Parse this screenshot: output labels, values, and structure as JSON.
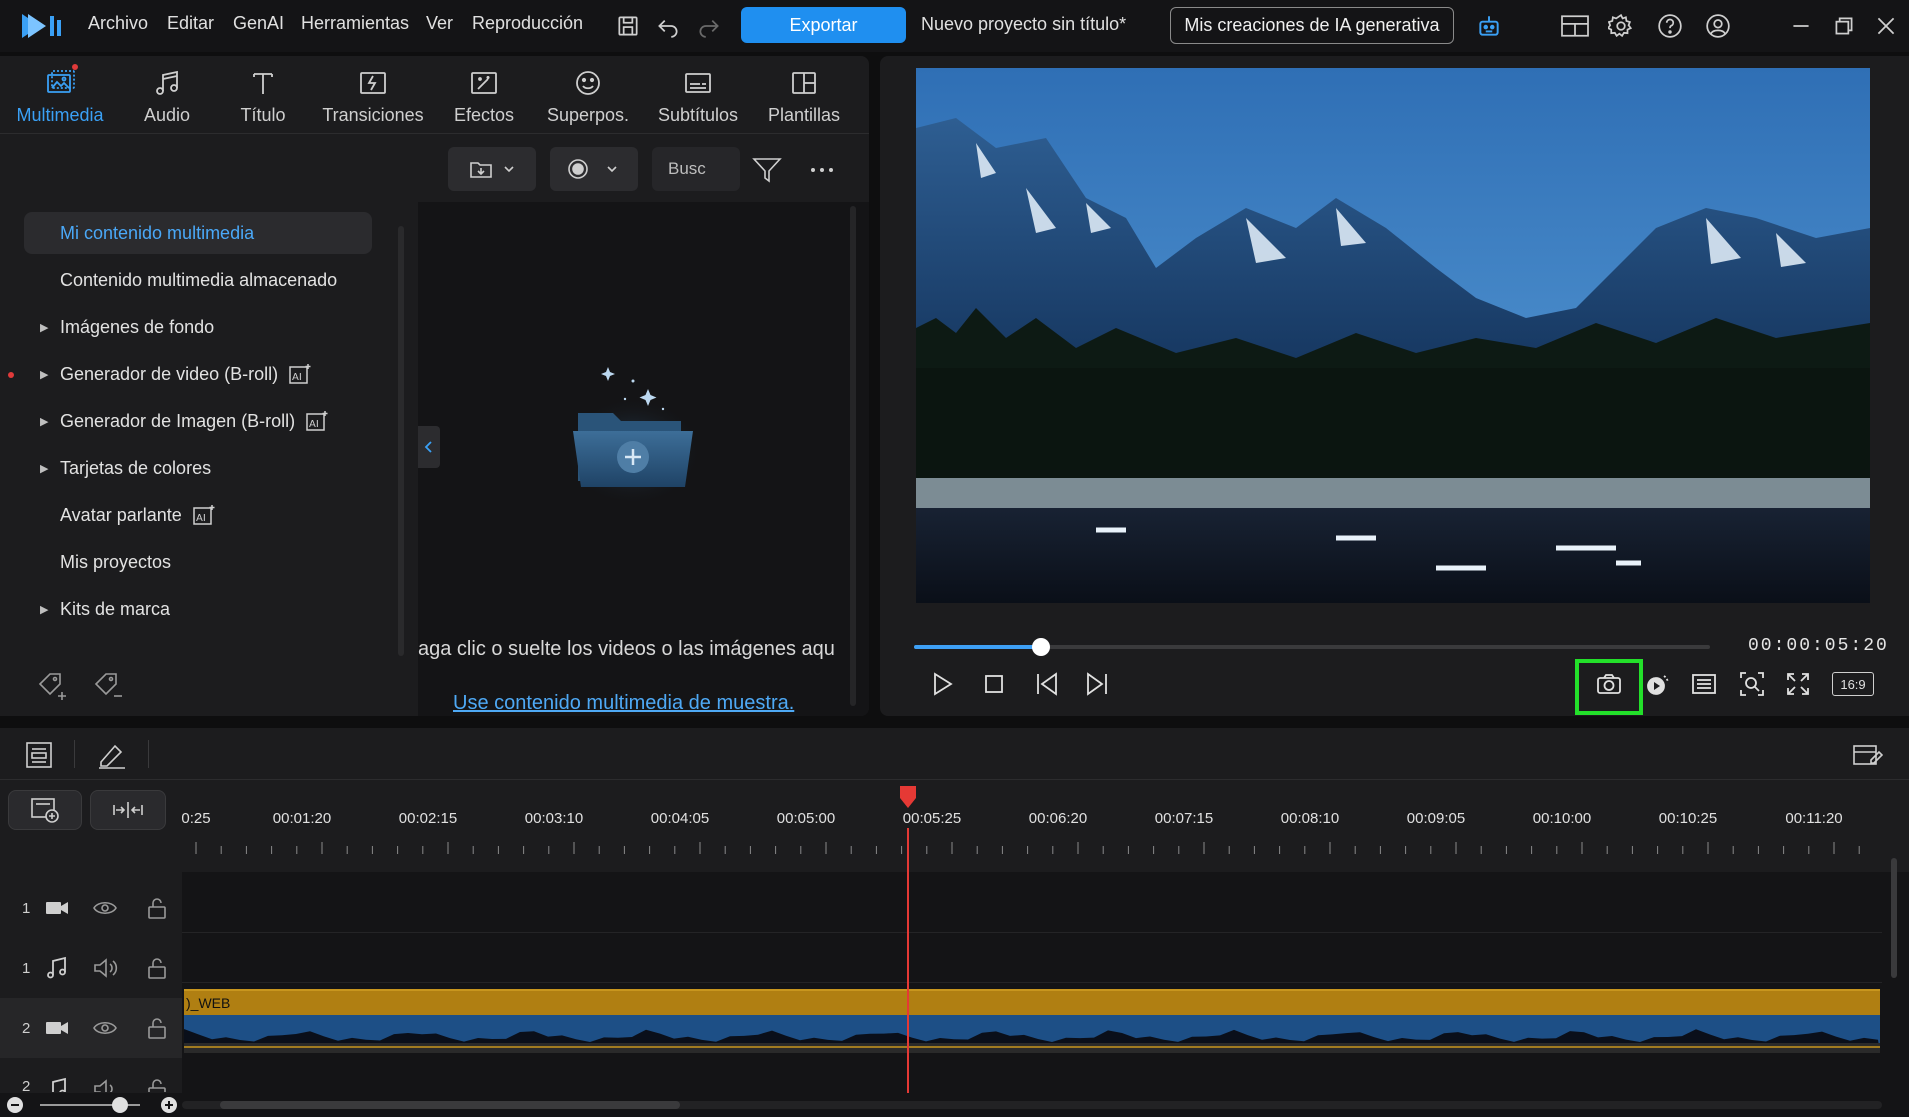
{
  "menu": [
    "Archivo",
    "Editar",
    "GenAI",
    "Herramientas",
    "Ver",
    "Reproducción"
  ],
  "export_label": "Exportar",
  "project_title": "Nuevo proyecto sin título*",
  "genai_button": "Mis creaciones de IA generativa",
  "tabs": [
    {
      "label": "Multimedia",
      "icon": "media-icon"
    },
    {
      "label": "Audio",
      "icon": "music-note-icon"
    },
    {
      "label": "Título",
      "icon": "title-text-icon"
    },
    {
      "label": "Transiciones",
      "icon": "transition-icon"
    },
    {
      "label": "Efectos",
      "icon": "effects-icon"
    },
    {
      "label": "Superpos.",
      "icon": "sticker-icon"
    },
    {
      "label": "Subtítulos",
      "icon": "subtitle-icon"
    },
    {
      "label": "Plantillas",
      "icon": "template-icon"
    }
  ],
  "sidebar": [
    {
      "label": "Mi contenido multimedia",
      "active": true,
      "arrow": false,
      "ai": false
    },
    {
      "label": "Contenido multimedia almacenado",
      "arrow": false,
      "ai": false
    },
    {
      "label": "Imágenes de fondo",
      "arrow": true,
      "ai": false
    },
    {
      "label": "Generador de video (B-roll)",
      "arrow": true,
      "ai": true
    },
    {
      "label": "Generador de Imagen (B-roll)",
      "arrow": true,
      "ai": true
    },
    {
      "label": "Tarjetas de colores",
      "arrow": true,
      "ai": false
    },
    {
      "label": "Avatar parlante",
      "arrow": false,
      "ai": true
    },
    {
      "label": "Mis proyectos",
      "arrow": false,
      "ai": false
    },
    {
      "label": "Kits de marca",
      "arrow": true,
      "ai": false
    }
  ],
  "media": {
    "search_placeholder": "Busc",
    "drop_hint": "aga clic o suelte los videos o las imágenes aqu",
    "sample_link": "Use contenido multimedia de muestra."
  },
  "preview": {
    "timecode": "00:00:05:20",
    "progress": 0.16,
    "aspect_ratio": "16:9"
  },
  "timeline": {
    "ticks": [
      "0:25",
      "00:01:20",
      "00:02:15",
      "00:03:10",
      "00:04:05",
      "00:05:00",
      "00:05:25",
      "00:06:20",
      "00:07:15",
      "00:08:10",
      "00:09:05",
      "00:10:00",
      "00:10:25",
      "00:11:20"
    ],
    "tracks": [
      {
        "num": "1",
        "type": "video"
      },
      {
        "num": "1",
        "type": "audio"
      },
      {
        "num": "2",
        "type": "video"
      },
      {
        "num": "2",
        "type": "audio"
      }
    ],
    "clip_label": ")_WEB"
  },
  "colors": {
    "accent": "#1f8ff0",
    "highlight": "#23e02a",
    "playhead": "#e53935",
    "clip": "#b07f12"
  }
}
